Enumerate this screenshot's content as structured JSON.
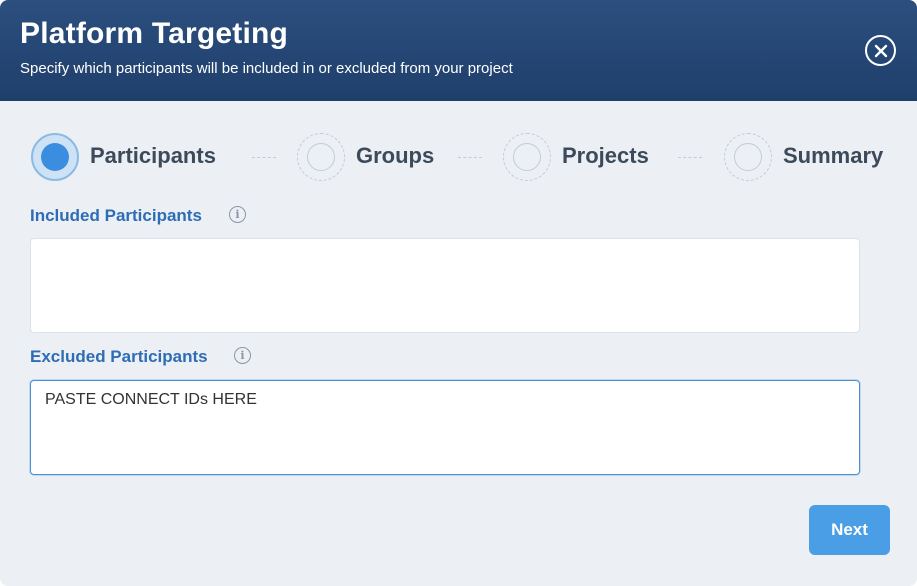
{
  "header": {
    "title": "Platform Targeting",
    "subtitle": "Specify which participants will be included in or excluded from your project",
    "close_icon": "close-circle-icon"
  },
  "stepper": {
    "active_index": 0,
    "steps": [
      {
        "label": "Participants",
        "state": "active"
      },
      {
        "label": "Groups",
        "state": "inactive"
      },
      {
        "label": "Projects",
        "state": "inactive"
      },
      {
        "label": "Summary",
        "state": "inactive"
      }
    ]
  },
  "included": {
    "label": "Included Participants",
    "value": "",
    "info_icon": "info-icon"
  },
  "excluded": {
    "label": "Excluded Participants",
    "value": "PASTE CONNECT IDs HERE",
    "info_icon": "info-icon"
  },
  "actions": {
    "next_label": "Next"
  },
  "colors": {
    "header": "#2c4f7f",
    "accent": "#3b8de0",
    "label": "#2e6db5",
    "button": "#4a9ee6"
  }
}
